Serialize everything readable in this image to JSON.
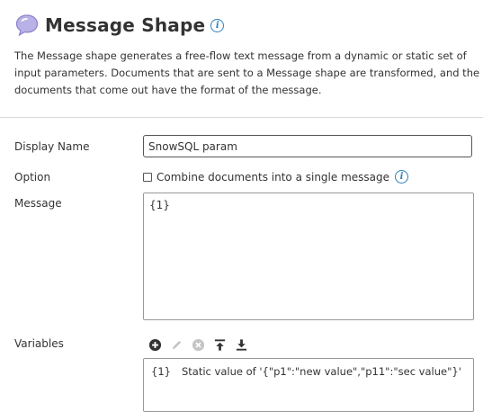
{
  "header": {
    "title": "Message Shape",
    "description": "The Message shape generates a free-flow text message from a dynamic or static set of input parameters. Documents that are sent to a Message shape are transformed, and the documents that come out have the format of the message."
  },
  "form": {
    "display_name_label": "Display Name",
    "display_name_value": "SnowSQL param",
    "option_label": "Option",
    "combine_label": "Combine documents into a single message",
    "combine_checked": false,
    "message_label": "Message",
    "message_value": "{1}",
    "variables_label": "Variables"
  },
  "variables_toolbar": {
    "icons": [
      "add-icon",
      "edit-icon",
      "remove-icon",
      "move-top-icon",
      "move-bottom-icon"
    ]
  },
  "variables": [
    {
      "key": "{1}",
      "value": "Static value of '{\"p1\":\"new value\",\"p11\":\"sec value\"}'"
    }
  ],
  "colors": {
    "info_blue": "#2f7fb8",
    "icon_dark": "#333333",
    "icon_disabled": "#c4c4c4"
  }
}
